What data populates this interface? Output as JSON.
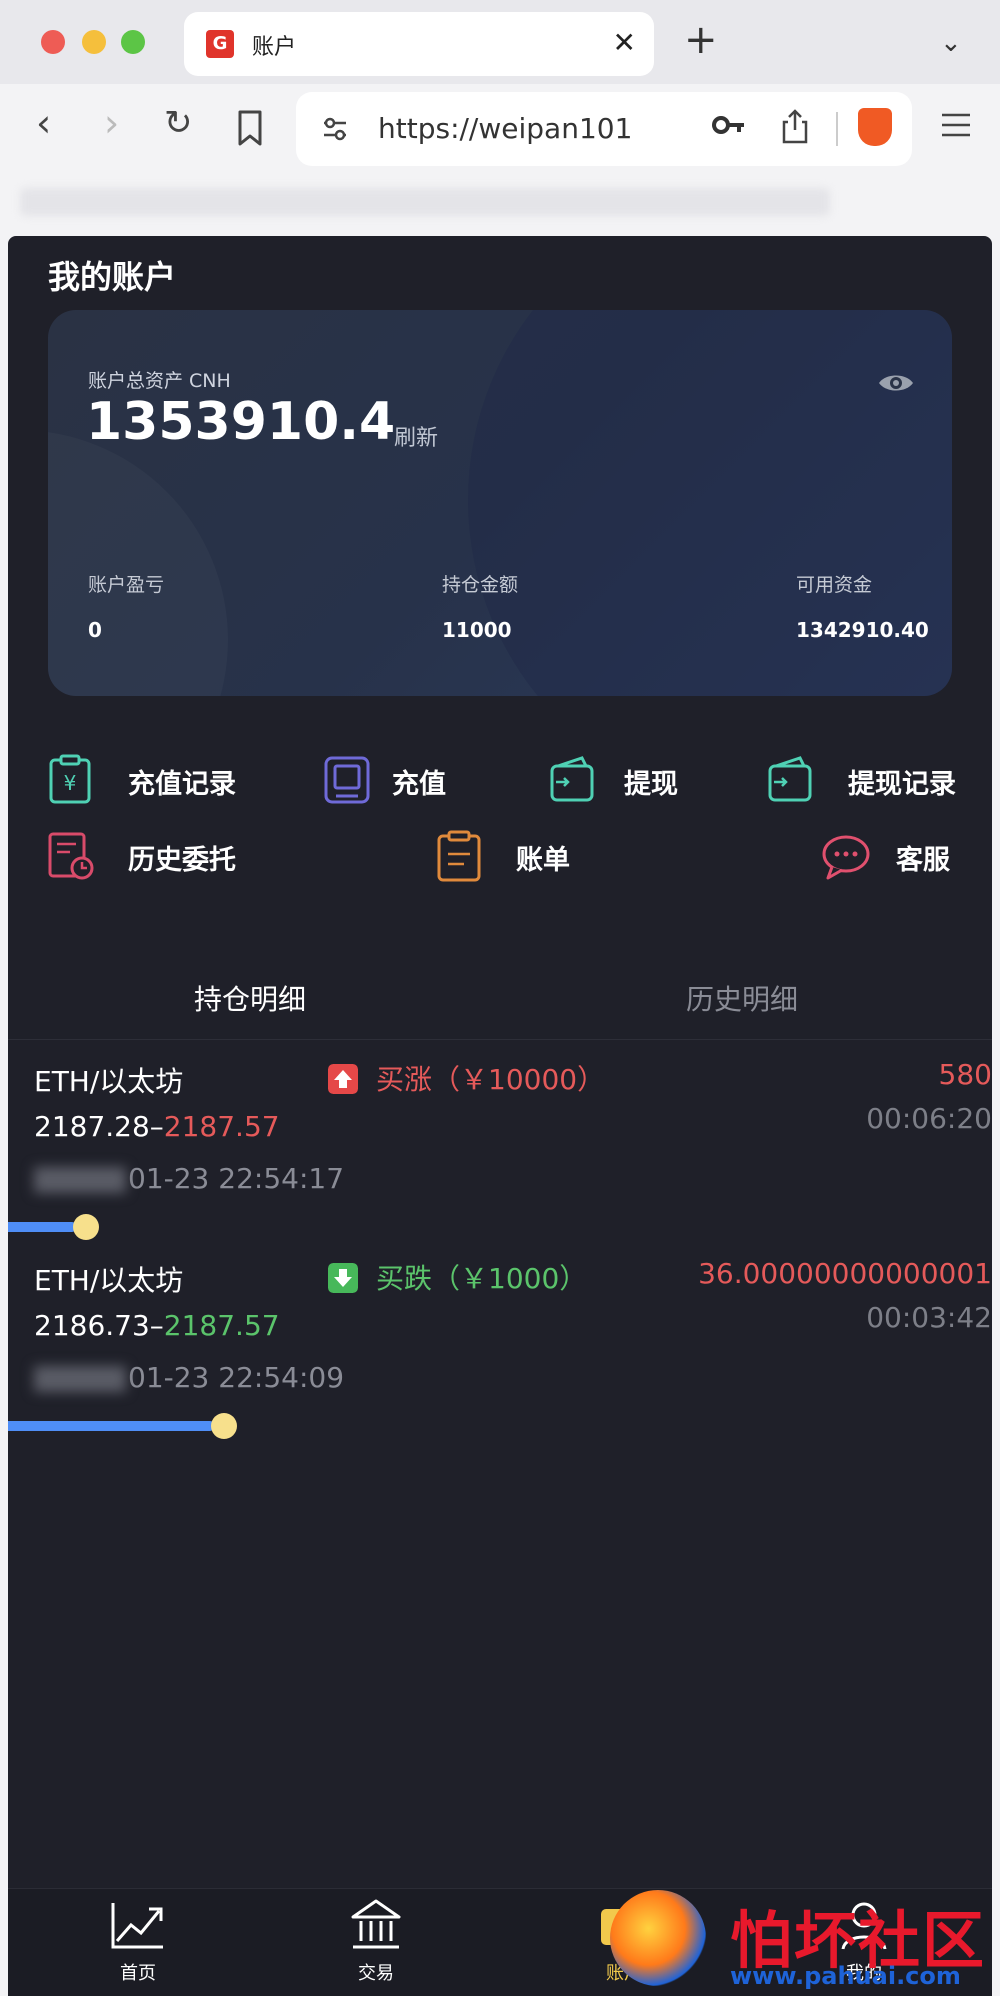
{
  "browser": {
    "tab_title": "账户",
    "tab_close": "✕",
    "new_tab": "+",
    "tab_menu": "⌄",
    "url": "https://weipan101",
    "back": "‹",
    "forward": "›",
    "reload": "↻"
  },
  "app": {
    "page_title": "我的账户",
    "card": {
      "total_label": "账户总资产 CNH",
      "total_value": "1353910.4",
      "refresh_label": "刷新",
      "stats": [
        {
          "label": "账户盈亏",
          "value": "0"
        },
        {
          "label": "持仓金额",
          "value": "11000"
        },
        {
          "label": "可用资金",
          "value": "1342910.40"
        }
      ]
    },
    "actions": [
      {
        "label": "充值记录",
        "icon": "deposit-record-icon",
        "color": "#4fd1b4"
      },
      {
        "label": "充值",
        "icon": "deposit-icon",
        "color": "#6f6ad8"
      },
      {
        "label": "提现",
        "icon": "withdraw-icon",
        "color": "#4fd1b4"
      },
      {
        "label": "提现记录",
        "icon": "withdraw-record-icon",
        "color": "#4fd1b4"
      },
      {
        "label": "历史委托",
        "icon": "history-orders-icon",
        "color": "#d94b6a"
      },
      {
        "label": "账单",
        "icon": "bill-icon",
        "color": "#e08a3c"
      },
      {
        "label": "客服",
        "icon": "customer-service-icon",
        "color": "#e0506e"
      }
    ],
    "tabs": [
      {
        "label": "持仓明细",
        "active": true
      },
      {
        "label": "历史明细",
        "active": false
      }
    ],
    "positions": [
      {
        "asset": "ETH/以太坊",
        "direction": "买涨（￥10000）",
        "direction_type": "up",
        "open_price": "2187.28–",
        "current_price": "2187.57",
        "pnl": "580",
        "timer": "00:06:20",
        "opened_at": "01-23 22:54:17",
        "progress": 0.07
      },
      {
        "asset": "ETH/以太坊",
        "direction": "买跌（￥1000）",
        "direction_type": "down",
        "open_price": "2186.73–",
        "current_price": "2187.57",
        "pnl": "36.00000000000001",
        "timer": "00:03:42",
        "opened_at": "01-23 22:54:09",
        "progress": 0.21
      }
    ],
    "bottom_nav": [
      {
        "label": "首页",
        "icon": "chart-trend-icon"
      },
      {
        "label": "交易",
        "icon": "bank-icon"
      },
      {
        "label": "账户",
        "icon": "wallet-icon",
        "active": true
      },
      {
        "label": "我的",
        "icon": "user-icon"
      }
    ]
  },
  "watermark": {
    "name": "怕坏社区",
    "url": "www.pahuai.com"
  },
  "colors": {
    "app_bg": "#1f2029",
    "up_red": "#e55a5a",
    "down_green": "#5bc46b",
    "accent_blue": "#4f8ef7",
    "knob_yellow": "#f7e08c",
    "active_nav": "#f2c94c"
  }
}
